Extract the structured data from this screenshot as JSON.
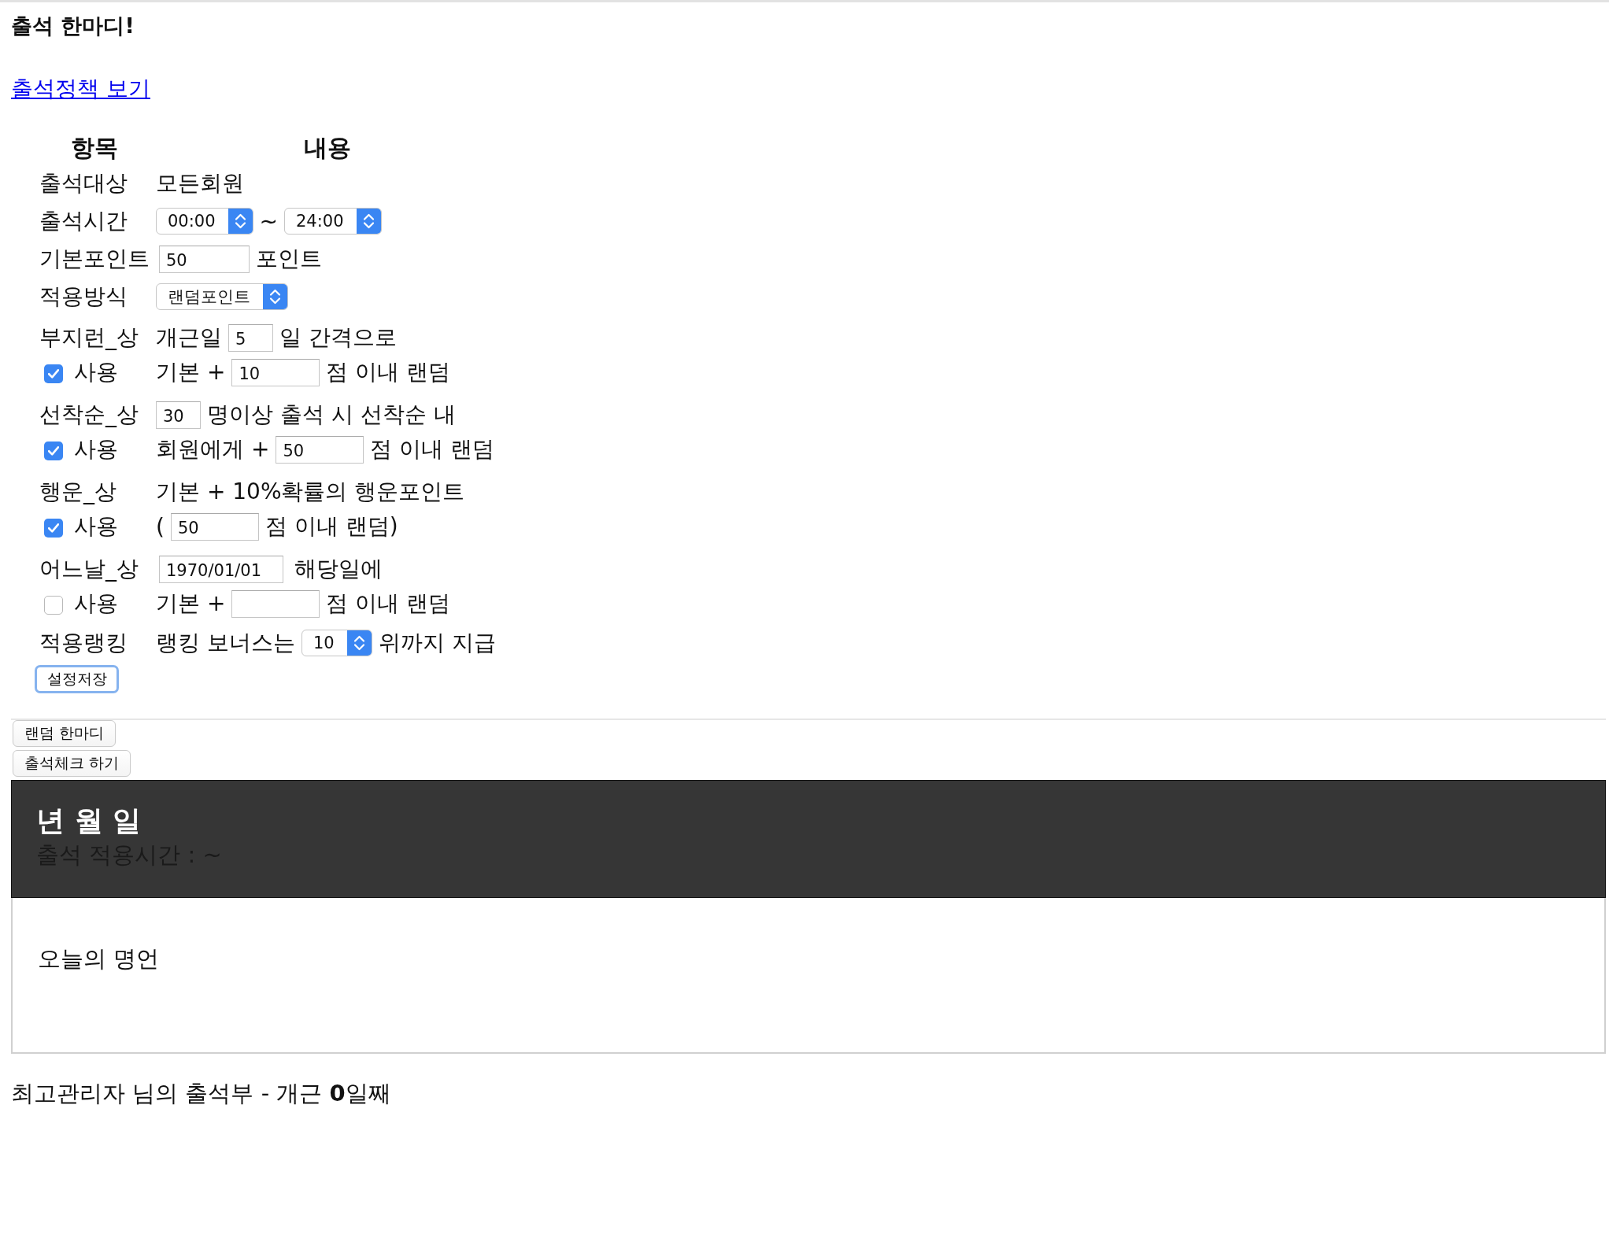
{
  "title": "출석 한마디!",
  "policy_link": "출석정책 보기",
  "settings": {
    "columns": [
      "항목",
      "내용"
    ],
    "rows": [
      {
        "kind": "plain",
        "label": "출석대상",
        "parts": [
          {
            "kind": "text",
            "text": "모든회원"
          }
        ]
      },
      {
        "kind": "plain",
        "label": "출석시간",
        "parts": [
          {
            "kind": "select",
            "value": "00:00"
          },
          {
            "kind": "text",
            "text": "~"
          },
          {
            "kind": "select",
            "value": "24:00"
          }
        ]
      },
      {
        "kind": "plain",
        "label": "기본포인트",
        "parts": [
          {
            "kind": "input",
            "value": "50"
          },
          {
            "kind": "text",
            "text": "포인트"
          }
        ]
      },
      {
        "kind": "plain",
        "label": "적용방식",
        "parts": [
          {
            "kind": "select",
            "value": "랜덤포인트"
          }
        ]
      },
      {
        "kind": "award",
        "label": "부지런_상",
        "parts": [
          {
            "kind": "text",
            "text": "개근일"
          },
          {
            "kind": "input",
            "value": "5"
          },
          {
            "kind": "text",
            "text": "일 간격으로"
          }
        ],
        "use": {
          "label": "사용",
          "checked": true
        },
        "detail": [
          {
            "kind": "text",
            "text": "기본 +"
          },
          {
            "kind": "input",
            "value": "10"
          },
          {
            "kind": "text",
            "text": "점 이내 랜덤"
          }
        ]
      },
      {
        "kind": "award",
        "label": "선착순_상",
        "parts": [
          {
            "kind": "input",
            "value": "30"
          },
          {
            "kind": "text",
            "text": "명이상 출석 시 선착순 내"
          }
        ],
        "use": {
          "label": "사용",
          "checked": true
        },
        "detail": [
          {
            "kind": "text",
            "text": "회원에게 +"
          },
          {
            "kind": "input",
            "value": "50"
          },
          {
            "kind": "text",
            "text": "점 이내 랜덤"
          }
        ]
      },
      {
        "kind": "award",
        "label": "행운_상",
        "parts": [
          {
            "kind": "text",
            "text": "기본 + 10%확률의 행운포인트"
          }
        ],
        "use": {
          "label": "사용",
          "checked": true
        },
        "detail": [
          {
            "kind": "text",
            "text": "("
          },
          {
            "kind": "input",
            "value": "50"
          },
          {
            "kind": "text",
            "text": "점 이내 랜덤)"
          }
        ]
      },
      {
        "kind": "award",
        "label": "어느날_상",
        "parts": [
          {
            "kind": "input",
            "value": "1970/01/01"
          },
          {
            "kind": "text",
            "text": "해당일에"
          }
        ],
        "use": {
          "label": "사용",
          "checked": false
        },
        "detail": [
          {
            "kind": "text",
            "text": "기본 +"
          },
          {
            "kind": "input"
          },
          {
            "kind": "text",
            "text": "점 이내 랜덤"
          }
        ]
      },
      {
        "kind": "plain",
        "label": "적용랭킹",
        "parts": [
          {
            "kind": "text",
            "text": "랭킹 보너스는"
          },
          {
            "kind": "select",
            "value": "10"
          },
          {
            "kind": "text",
            "text": "위까지 지급"
          }
        ]
      }
    ],
    "save_button": "설정저장"
  },
  "buttons": [
    "랜덤 한마디",
    "출석체크 하기"
  ],
  "date_panel": {
    "date": "년 월 일",
    "time_range": "출석 적용시간 : ~"
  },
  "quote_panel": {
    "title": "오늘의 명언"
  },
  "footer": "최고관리자 님의 출석부 - 개근 **0**일째"
}
